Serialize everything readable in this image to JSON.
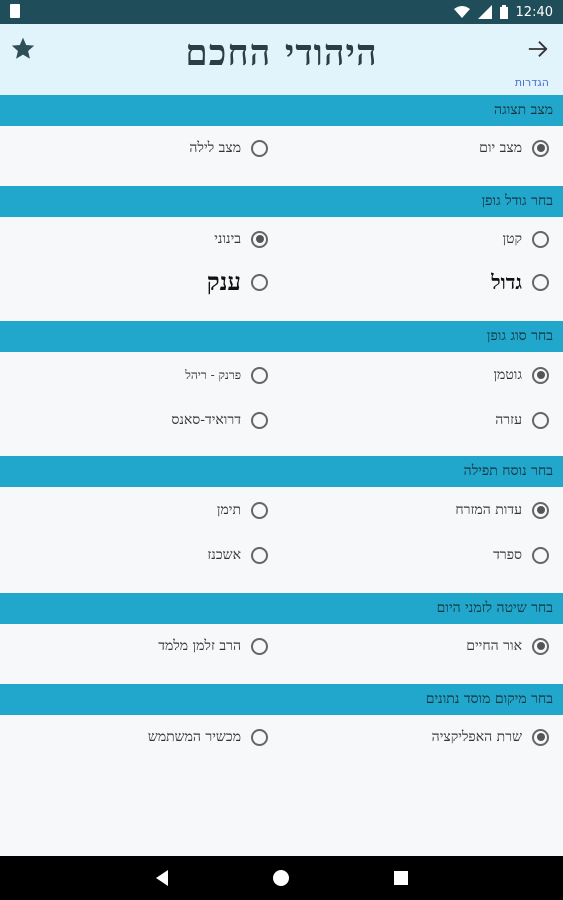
{
  "status_bar": {
    "time": "12:40",
    "icons": [
      "wifi-icon",
      "signal-icon",
      "battery-icon"
    ]
  },
  "header": {
    "title": "היהודי החכם",
    "settings_link": "הגדרות",
    "icons": {
      "left": "star-icon",
      "right": "back-arrow-icon"
    }
  },
  "sections": [
    {
      "header": "מצב תצוגה",
      "options": [
        {
          "label": "מצב יום",
          "checked": true
        },
        {
          "label": "מצב לילה",
          "checked": false
        }
      ]
    },
    {
      "header": "בחר גודל גופן",
      "options": [
        {
          "label": "קטן",
          "checked": false
        },
        {
          "label": "בינוני",
          "checked": true
        },
        {
          "label": "גדול",
          "checked": false
        },
        {
          "label": "ענק",
          "checked": false
        }
      ]
    },
    {
      "header": "בחר סוג גופן",
      "options": [
        {
          "label": "גוטמן",
          "checked": true
        },
        {
          "label": "פרנק - ריהל",
          "checked": false
        },
        {
          "label": "עזרה",
          "checked": false
        },
        {
          "label": "דרואיד-סאנס",
          "checked": false
        }
      ]
    },
    {
      "header": "בחר נוסח תפילה",
      "options": [
        {
          "label": "עדות המזרח",
          "checked": true
        },
        {
          "label": "תימן",
          "checked": false
        },
        {
          "label": "ספרד",
          "checked": false
        },
        {
          "label": "אשכנז",
          "checked": false
        }
      ]
    },
    {
      "header": "בחר שיטה לזמני היום",
      "options": [
        {
          "label": "אור החיים",
          "checked": true
        },
        {
          "label": "הרב זלמן מלמד",
          "checked": false
        }
      ]
    },
    {
      "header": "בחר מיקום מוסד נתונים",
      "options": [
        {
          "label": "שרת האפליקציה",
          "checked": true
        },
        {
          "label": "מכשיר המשתמש",
          "checked": false
        }
      ]
    }
  ],
  "colors": {
    "status_bar": "#1f4d59",
    "header_bg": "#e2f4fb",
    "section_header_bg": "#21a7cc",
    "link": "#4a6fd1"
  }
}
